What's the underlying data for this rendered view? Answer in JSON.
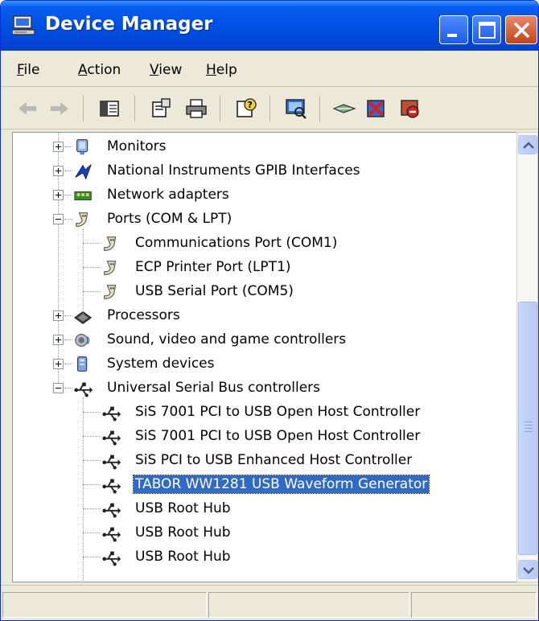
{
  "window": {
    "title": "Device Manager",
    "icon": "computer-icon",
    "controls": {
      "minimize": "minimize-icon",
      "maximize": "maximize-icon",
      "close": "close-icon"
    }
  },
  "menu": {
    "items": [
      {
        "label": "File",
        "accel": "F"
      },
      {
        "label": "Action",
        "accel": "A"
      },
      {
        "label": "View",
        "accel": "V"
      },
      {
        "label": "Help",
        "accel": "H"
      }
    ]
  },
  "toolbar": {
    "buttons": [
      "back-arrow-icon",
      "forward-arrow-icon",
      "show-hide-console-tree-icon",
      "properties-icon",
      "print-icon",
      "help-icon",
      "scan-hardware-icon",
      "update-driver-icon",
      "uninstall-icon",
      "disable-icon"
    ]
  },
  "tree": {
    "nodes": [
      {
        "label": "Monitors",
        "level": 0,
        "expander": "plus",
        "icon": "monitor-icon"
      },
      {
        "label": "National Instruments GPIB Interfaces",
        "level": 0,
        "expander": "plus",
        "icon": "ni-gpib-icon"
      },
      {
        "label": "Network adapters",
        "level": 0,
        "expander": "plus",
        "icon": "network-card-icon"
      },
      {
        "label": "Ports (COM & LPT)",
        "level": 0,
        "expander": "minus",
        "icon": "port-icon"
      },
      {
        "label": "Communications Port (COM1)",
        "level": 1,
        "icon": "port-icon"
      },
      {
        "label": "ECP Printer Port (LPT1)",
        "level": 1,
        "icon": "port-icon"
      },
      {
        "label": "USB Serial Port (COM5)",
        "level": 1,
        "icon": "port-icon"
      },
      {
        "label": "Processors",
        "level": 0,
        "expander": "plus",
        "icon": "processor-icon"
      },
      {
        "label": "Sound, video and game controllers",
        "level": 0,
        "expander": "plus",
        "icon": "speaker-icon"
      },
      {
        "label": "System devices",
        "level": 0,
        "expander": "plus",
        "icon": "system-device-icon"
      },
      {
        "label": "Universal Serial Bus controllers",
        "level": 0,
        "expander": "minus",
        "icon": "usb-icon"
      },
      {
        "label": "SiS 7001 PCI to USB Open Host Controller",
        "level": 1,
        "icon": "usb-icon"
      },
      {
        "label": "SiS 7001 PCI to USB Open Host Controller",
        "level": 1,
        "icon": "usb-icon"
      },
      {
        "label": "SiS PCI to USB Enhanced Host Controller",
        "level": 1,
        "icon": "usb-icon"
      },
      {
        "label": "TABOR WW1281 USB Waveform Generator",
        "level": 1,
        "icon": "usb-icon",
        "selected": true
      },
      {
        "label": "USB Root Hub",
        "level": 1,
        "icon": "usb-icon"
      },
      {
        "label": "USB Root Hub",
        "level": 1,
        "icon": "usb-icon"
      },
      {
        "label": "USB Root Hub",
        "level": 1,
        "icon": "usb-icon"
      }
    ]
  },
  "scrollbar": {
    "position_fraction": 0.39,
    "visible_fraction": 0.56
  },
  "colors": {
    "titlebar": "#0052e6",
    "selection": "#316ac5",
    "chrome": "#ece9d8"
  }
}
